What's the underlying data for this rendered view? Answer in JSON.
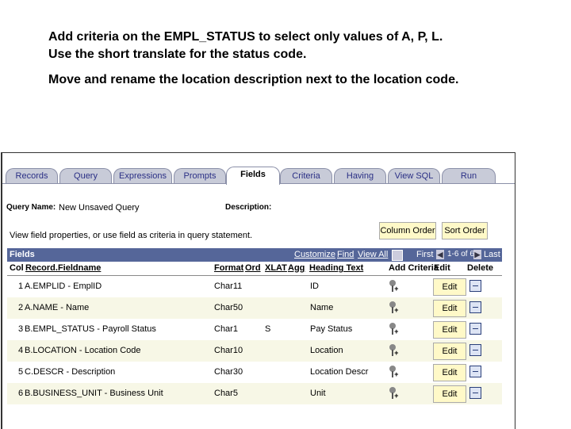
{
  "instructions": {
    "line1": "Add criteria on the EMPL_STATUS to select only values of A, P, L. Use the short translate for the status code.",
    "line2": "Move and rename the location description next to the location code."
  },
  "tabs": [
    "Records",
    "Query",
    "Expressions",
    "Prompts",
    "Fields",
    "Criteria",
    "Having",
    "View SQL",
    "Run"
  ],
  "active_tab": "Fields",
  "query": {
    "name_label": "Query Name:",
    "name_value": "New Unsaved Query",
    "description_label": "Description:",
    "hint": "View field properties, or use field as criteria in query statement."
  },
  "buttons": {
    "column_order": "Column Order",
    "sort_order": "Sort Order",
    "edit": "Edit"
  },
  "grid": {
    "title": "Fields",
    "customize": "Customize",
    "find": "Find",
    "view_all": "View All",
    "first": "First",
    "range": "1-6 of 6",
    "last": "Last",
    "columns": [
      "Col",
      "Record.Fieldname",
      "Format",
      "Ord",
      "XLAT",
      "Agg",
      "Heading Text",
      "Add Criteria",
      "Edit",
      "Delete"
    ],
    "rows": [
      {
        "col": "1",
        "field": "A.EMPLID - EmplID",
        "format": "Char11",
        "ord": "",
        "xlat": "",
        "agg": "",
        "heading": "ID"
      },
      {
        "col": "2",
        "field": "A.NAME - Name",
        "format": "Char50",
        "ord": "",
        "xlat": "",
        "agg": "",
        "heading": "Name"
      },
      {
        "col": "3",
        "field": "B.EMPL_STATUS - Payroll Status",
        "format": "Char1",
        "ord": "",
        "xlat": "S",
        "agg": "",
        "heading": "Pay Status"
      },
      {
        "col": "4",
        "field": "B.LOCATION - Location Code",
        "format": "Char10",
        "ord": "",
        "xlat": "",
        "agg": "",
        "heading": "Location"
      },
      {
        "col": "5",
        "field": "C.DESCR - Description",
        "format": "Char30",
        "ord": "",
        "xlat": "",
        "agg": "",
        "heading": "Location Descr"
      },
      {
        "col": "6",
        "field": "B.BUSINESS_UNIT - Business Unit",
        "format": "Char5",
        "ord": "",
        "xlat": "",
        "agg": "",
        "heading": "Unit"
      }
    ]
  },
  "colors": {
    "tab_bg": "#c8cbd8",
    "grid_header": "#556699",
    "button_bg": "#fff9c8",
    "row_alt": "#f7f7e6"
  }
}
